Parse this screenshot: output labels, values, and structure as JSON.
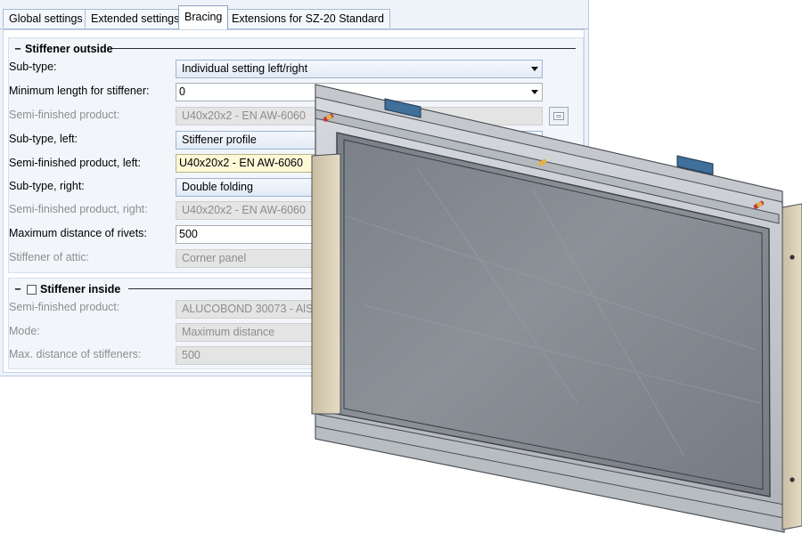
{
  "tabs": [
    {
      "label": "Global settings"
    },
    {
      "label": "Extended settings"
    },
    {
      "label": "Bracing"
    },
    {
      "label": "Extensions for SZ-20 Standard"
    }
  ],
  "active_tab": "Bracing",
  "outside_group": {
    "title": "Stiffener outside",
    "rows": [
      {
        "label": "Sub-type:",
        "value": "Individual setting left/right"
      },
      {
        "label": "Minimum length for stiffener:",
        "value": "0"
      },
      {
        "label": "Semi-finished product:",
        "value": "U40x20x2 - EN AW-6060"
      },
      {
        "label": "Sub-type, left:",
        "value": "Stiffener profile"
      },
      {
        "label": "Semi-finished product, left:",
        "value": "U40x20x2 - EN AW-6060"
      },
      {
        "label": "Sub-type, right:",
        "value": "Double folding"
      },
      {
        "label": "Semi-finished product, right:",
        "value": "U40x20x2 - EN AW-6060"
      },
      {
        "label": "Maximum distance of rivets:",
        "value": "500"
      },
      {
        "label": "Stiffener of attic:",
        "value": "Corner panel"
      }
    ]
  },
  "inside_group": {
    "title": "Stiffener inside",
    "checked": false,
    "rows": [
      {
        "label": "Semi-finished product:",
        "value": "ALUCOBOND 30073 - AlSiMg"
      },
      {
        "label": "Mode:",
        "value": "Maximum distance"
      },
      {
        "label": "Max. distance of stiffeners:",
        "value": "500"
      }
    ]
  },
  "colors": {
    "dialog_bg": "#eef3fa",
    "group_bg": "#f2f6fb",
    "highlight_field": "#fdf9d7",
    "panel_frame": "#c9cdd3",
    "glass": "#7f858d",
    "side_profile": "#d9cdb4",
    "clip_blue": "#3f6f9a"
  }
}
